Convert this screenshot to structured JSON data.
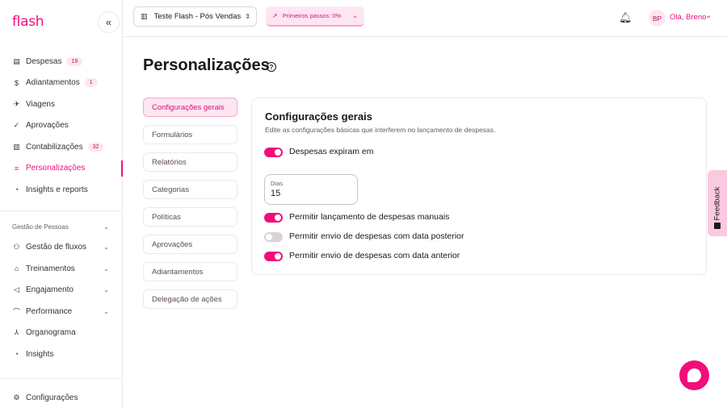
{
  "app": {
    "logo": "flash"
  },
  "sidebar": {
    "collapse_icon": "«",
    "items": [
      {
        "label": "Despesas",
        "icon": "receipt-icon",
        "glyph": "▤",
        "badge": "19"
      },
      {
        "label": "Adiantamentos",
        "icon": "dollar-icon",
        "glyph": "$",
        "badge": "1"
      },
      {
        "label": "Viagens",
        "icon": "plane-icon",
        "glyph": "✈"
      },
      {
        "label": "Aprovações",
        "icon": "check-circle-icon",
        "glyph": "✓"
      },
      {
        "label": "Contabilizações",
        "icon": "ledger-icon",
        "glyph": "▥",
        "badge": "32"
      },
      {
        "label": "Personalizações",
        "icon": "sliders-icon",
        "glyph": "≡",
        "active": true
      },
      {
        "label": "Insights e reports",
        "icon": "pie-chart-icon",
        "glyph": "◔"
      }
    ],
    "section_title": "Gestão de Pessoas",
    "section_items": [
      {
        "label": "Gestão de fluxos",
        "icon": "flow-icon",
        "glyph": "⚇",
        "chevron": true
      },
      {
        "label": "Treinamentos",
        "icon": "graduation-icon",
        "glyph": "⌂",
        "chevron": true
      },
      {
        "label": "Engajamento",
        "icon": "megaphone-icon",
        "glyph": "◁",
        "chevron": true
      },
      {
        "label": "Performance",
        "icon": "chart-line-icon",
        "glyph": "⌒",
        "chevron": true
      },
      {
        "label": "Organograma",
        "icon": "org-chart-icon",
        "glyph": "⅄"
      },
      {
        "label": "Insights",
        "icon": "pie-chart-icon",
        "glyph": "◔"
      }
    ],
    "bottom_item": {
      "label": "Configurações",
      "icon": "gear-icon",
      "glyph": "⚙"
    }
  },
  "topbar": {
    "company": "Teste Flash - Pós Vendas",
    "steps": "Primeiros passos: 0%",
    "avatar_initials": "BP",
    "greeting": "Olá, Breno"
  },
  "page": {
    "title": "Personalizações",
    "tabs": [
      {
        "label": "Configurações gerais",
        "active": true
      },
      {
        "label": "Formulários"
      },
      {
        "label": "Relatórios"
      },
      {
        "label": "Categorias"
      },
      {
        "label": "Políticas"
      },
      {
        "label": "Aprovações"
      },
      {
        "label": "Adiantamentos"
      },
      {
        "label": "Delegação de ações"
      }
    ],
    "card": {
      "title": "Configurações gerais",
      "subtitle": "Edite as configurações básicas que interferem no lançamento de despesas.",
      "expire_toggle": {
        "label": "Despesas expiram em",
        "on": true
      },
      "days_input": {
        "label": "Dias",
        "value": "15"
      },
      "toggles": [
        {
          "label": "Permitir lançamento de despesas manuais",
          "on": true
        },
        {
          "label": "Permitir envio de despesas com data posterior",
          "on": false
        },
        {
          "label": "Permitir envio de despesas com data anterior",
          "on": true
        }
      ]
    }
  },
  "feedback": {
    "label": "Feedback"
  },
  "colors": {
    "accent": "#f20d7a",
    "accent_light": "#fde6f1",
    "text": "#1d161b"
  }
}
